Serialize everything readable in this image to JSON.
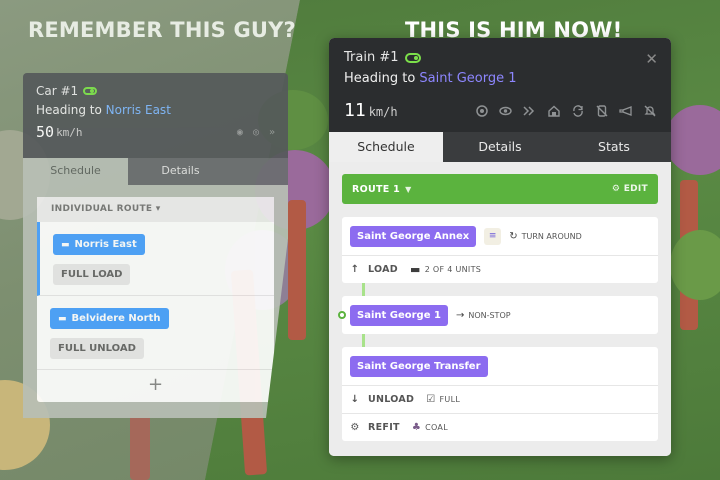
{
  "headlines": {
    "left": "REMEMBER THIS GUY?",
    "right": "THIS IS HIM NOW!"
  },
  "old_car": {
    "title": "Car #1",
    "heading_prefix": "Heading to",
    "destination": "Norris East",
    "speed_value": "50",
    "speed_unit": "km/h",
    "tabs": [
      "Schedule",
      "Details"
    ],
    "route_label": "INDIVIDUAL ROUTE",
    "stops": [
      {
        "name": "Norris East",
        "action": "FULL LOAD"
      },
      {
        "name": "Belvidere North",
        "action": "FULL UNLOAD"
      }
    ],
    "add_symbol": "+"
  },
  "train": {
    "title": "Train #1",
    "heading_prefix": "Heading to",
    "destination": "Saint George 1",
    "speed_value": "11",
    "speed_unit": "km/h",
    "close_symbol": "✕",
    "icons": [
      "locate-icon",
      "eye-icon",
      "skip-icon",
      "depot-icon",
      "reverse-icon",
      "no-entry-icon",
      "horn-icon",
      "disable-icon"
    ],
    "tabs": [
      "Schedule",
      "Details",
      "Stats"
    ],
    "route": {
      "label": "ROUTE 1",
      "edit_label": "EDIT"
    },
    "stops": [
      {
        "name": "Saint George Annex",
        "mode_label": "TURN AROUND",
        "sub_label": "LOAD",
        "sub_extra": "2 OF 4 UNITS"
      },
      {
        "name": "Saint George 1",
        "mode_label": "NON-STOP"
      },
      {
        "name": "Saint George Transfer",
        "subs": [
          {
            "label": "UNLOAD",
            "extra": "FULL"
          },
          {
            "label": "REFIT",
            "extra": "COAL"
          }
        ]
      }
    ]
  },
  "colors": {
    "accent_green": "#5bb33e",
    "stop_purple": "#8c6cf0",
    "old_stop_blue": "#4aa2ff",
    "destination_link": "#8d86ff"
  }
}
